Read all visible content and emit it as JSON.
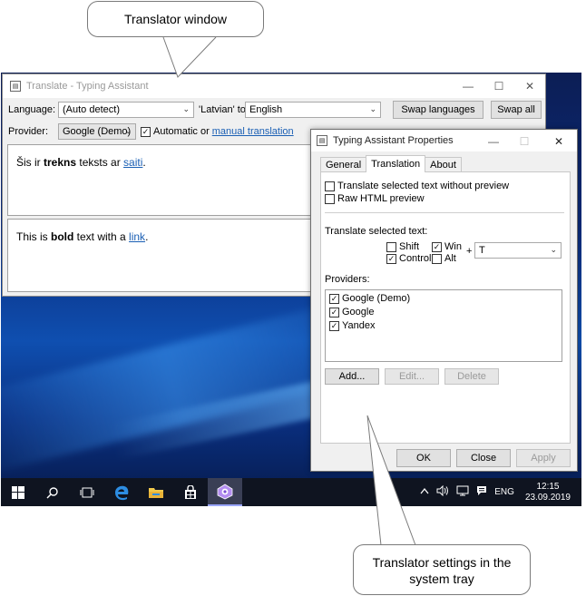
{
  "callouts": {
    "top": "Translator window",
    "bottom": "Translator settings in the system tray"
  },
  "translator": {
    "title": "Translate - Typing Assistant",
    "language_label": "Language:",
    "source_language": "(Auto detect)",
    "detected_to_label": "'Latvian' to",
    "target_language": "English",
    "swap_languages_button": "Swap languages",
    "swap_all_button": "Swap all",
    "provider_label": "Provider:",
    "provider_value": "Google (Demo)",
    "automatic_or_label": "Automatic or",
    "manual_translation_link": "manual translation",
    "source_text": {
      "part1": "Šis ir ",
      "bold": "trekns",
      "part2": " teksts ar ",
      "link": "saiti",
      "part3": "."
    },
    "translated_text": {
      "part1": "This is ",
      "bold": "bold",
      "part2": " text with a ",
      "link": "link",
      "part3": "."
    }
  },
  "properties_dialog": {
    "title": "Typing Assistant Properties",
    "tabs": [
      "General",
      "Translation",
      "About"
    ],
    "active_tab": "Translation",
    "translate_without_preview": "Translate selected text without preview",
    "raw_html_preview": "Raw HTML preview",
    "translate_selected_label": "Translate selected text:",
    "modifiers": {
      "shift": "Shift",
      "win": "Win",
      "control": "Control",
      "alt": "Alt",
      "plus": "+",
      "key": "T"
    },
    "providers_label": "Providers:",
    "providers": [
      "Google (Demo)",
      "Google",
      "Yandex"
    ],
    "add_button": "Add...",
    "edit_button": "Edit...",
    "delete_button": "Delete",
    "ok_button": "OK",
    "close_button": "Close",
    "apply_button": "Apply"
  },
  "taskbar": {
    "language": "ENG",
    "time": "12:15",
    "date": "23.09.2019"
  },
  "colors": {
    "link": "#1a5fb4",
    "taskbar": "#0f1420",
    "desktop": "#0a2a7a",
    "edge_blue": "#2d8de2"
  }
}
